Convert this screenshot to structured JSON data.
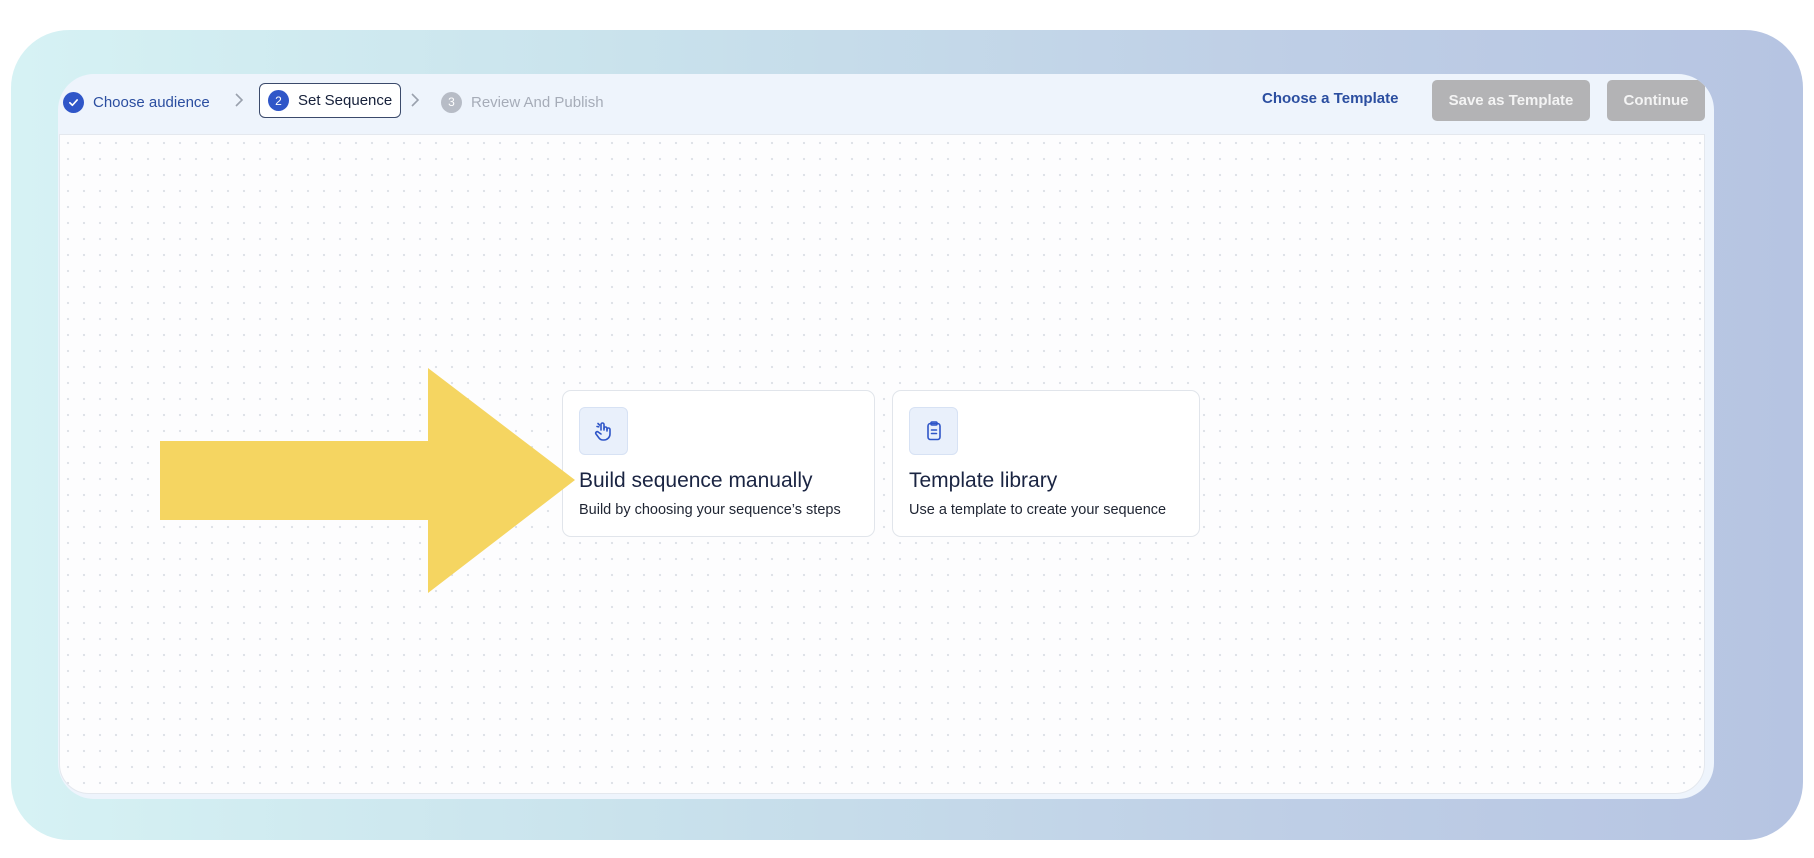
{
  "steps": [
    {
      "number": "1",
      "label": "Choose audience",
      "state": "done"
    },
    {
      "number": "2",
      "label": "Set Sequence",
      "state": "active"
    },
    {
      "number": "3",
      "label": "Review And Publish",
      "state": "pending"
    }
  ],
  "header": {
    "choose_template_link": "Choose a Template",
    "save_template_button": "Save as Template",
    "continue_button": "Continue"
  },
  "cards": {
    "manual": {
      "title": "Build sequence manually",
      "description": "Build by choosing your sequence’s steps",
      "icon": "hand-pointer-icon"
    },
    "template": {
      "title": "Template library",
      "description": "Use a template to create your sequence",
      "icon": "clipboard-icon"
    }
  },
  "colors": {
    "accent": "#2f56c8",
    "link": "#2b4ea0",
    "disabled_button": "#b3b3b5",
    "annotation_arrow": "#f5d561"
  }
}
